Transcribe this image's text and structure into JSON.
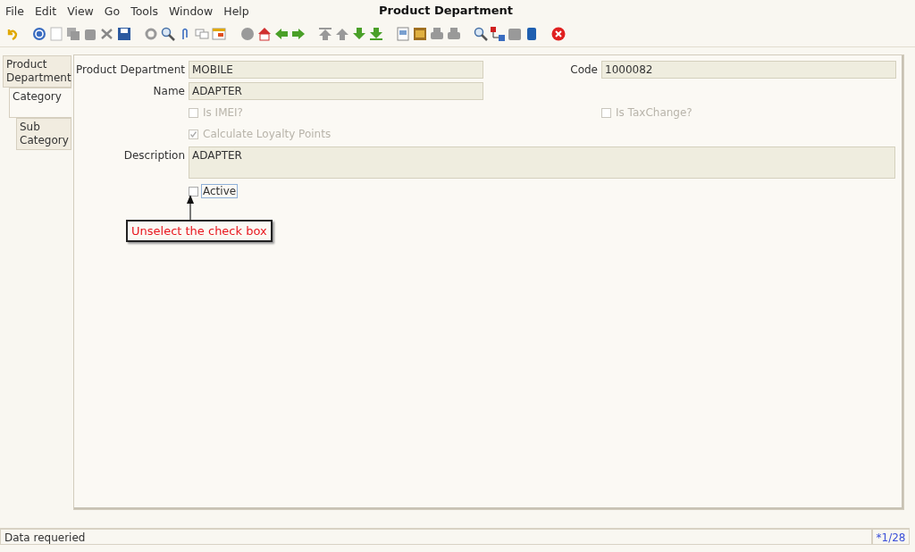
{
  "menu": [
    {
      "label": "File"
    },
    {
      "label": "Edit"
    },
    {
      "label": "View"
    },
    {
      "label": "Go"
    },
    {
      "label": "Tools"
    },
    {
      "label": "Window"
    },
    {
      "label": "Help"
    }
  ],
  "window": {
    "title": "Product Department"
  },
  "tabs": [
    {
      "label": "Product Department",
      "selected": false,
      "children": [
        {
          "label": "Category",
          "selected": true,
          "children": [
            {
              "label": "Sub Category",
              "selected": false
            }
          ]
        }
      ]
    }
  ],
  "form": {
    "product_department": {
      "label": "Product Department",
      "value": "MOBILE"
    },
    "code": {
      "label": "Code",
      "value": "1000082"
    },
    "name": {
      "label": "Name",
      "value": "ADAPTER"
    },
    "is_imei": {
      "label": "Is IMEI?",
      "checked": false,
      "disabled": true
    },
    "is_taxchange": {
      "label": "Is TaxChange?",
      "checked": false,
      "disabled": true
    },
    "calculate_loyalty": {
      "label": "Calculate Loyalty Points",
      "checked": true,
      "disabled": true
    },
    "description": {
      "label": "Description",
      "value": "ADAPTER"
    },
    "active": {
      "label": "Active",
      "checked": false,
      "disabled": false,
      "focused": true
    }
  },
  "annotation": {
    "text": "Unselect the check box"
  },
  "status_bar": {
    "message": "Data requeried",
    "record": "*1/28"
  }
}
